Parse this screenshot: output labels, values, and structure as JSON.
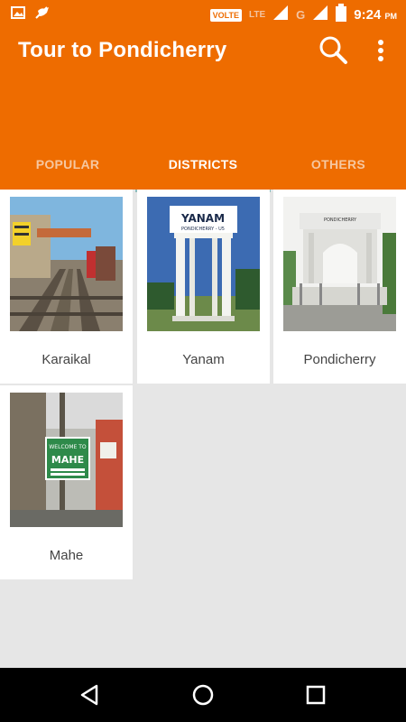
{
  "status_bar": {
    "volte": "VOLTE",
    "lte": "LTE",
    "g": "G",
    "time": "9:24",
    "ampm": "PM"
  },
  "app_bar": {
    "title": "Tour to Pondicherry",
    "background_color": "#ee6c00"
  },
  "tabs": [
    {
      "label": "POPULAR",
      "active": false
    },
    {
      "label": "DISTRICTS",
      "active": true
    },
    {
      "label": "OTHERS",
      "active": false
    }
  ],
  "districts": [
    {
      "name": "Karaikal",
      "sign_text": ""
    },
    {
      "name": "Yanam",
      "sign_text": "YANAM",
      "sign_sub": "PONDICHERRY - U5"
    },
    {
      "name": "Pondicherry",
      "sign_text": "PONDICHERRY"
    },
    {
      "name": "Mahe",
      "sign_text": "MAHE",
      "sign_top": "WELCOME TO"
    }
  ]
}
